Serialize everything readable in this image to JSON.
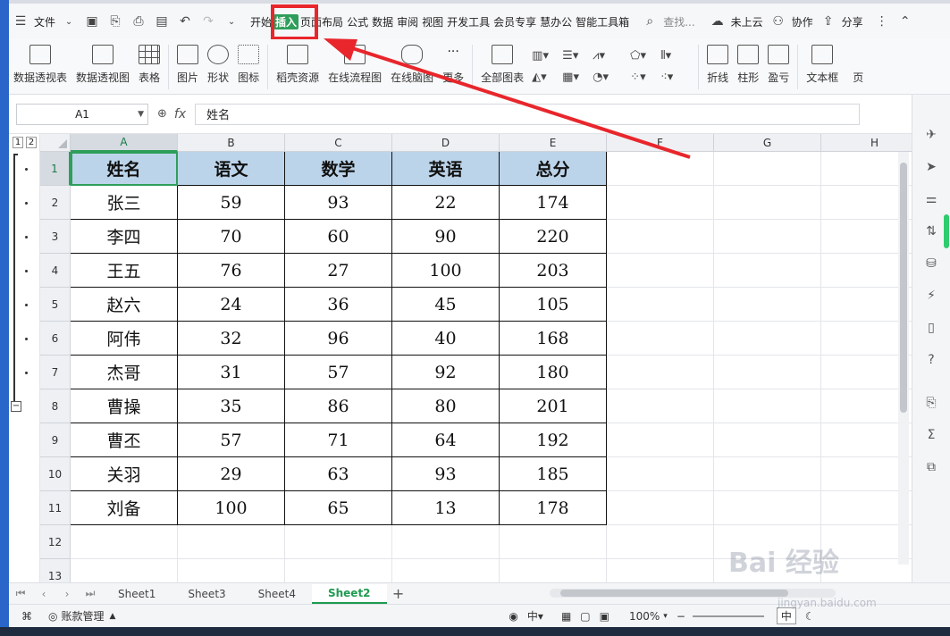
{
  "menubar": {
    "file_label": "文件",
    "tabs": [
      "开始",
      "插入",
      "页面布局",
      "公式",
      "数据",
      "审阅",
      "视图",
      "开发工具",
      "会员专享",
      "慧办公",
      "智能工具箱"
    ],
    "search_label": "查找...",
    "cloud_label": "未上云",
    "collab_label": "协作",
    "share_label": "分享"
  },
  "ribbon": {
    "pivot_table": "数据透视表",
    "pivot_chart": "数据透视图",
    "table": "表格",
    "picture": "图片",
    "shape": "形状",
    "icon": "图标",
    "resources": "稻壳资源",
    "flowchart": "在线流程图",
    "mindmap": "在线脑图",
    "more": "更多",
    "all_charts": "全部图表",
    "line": "折线",
    "column": "柱形",
    "winloss": "盈亏",
    "textbox": "文本框",
    "page": "页"
  },
  "formula_bar": {
    "name_box": "A1",
    "fx": "fx",
    "content": "姓名"
  },
  "columns": [
    "A",
    "B",
    "C",
    "D",
    "E",
    "F",
    "G",
    "H"
  ],
  "rows": [
    "1",
    "2",
    "3",
    "4",
    "5",
    "6",
    "7",
    "8",
    "9",
    "10",
    "11",
    "12",
    "13"
  ],
  "outline_levels": [
    "1",
    "2"
  ],
  "table": {
    "headers": [
      "姓名",
      "语文",
      "数学",
      "英语",
      "总分"
    ],
    "rows": [
      [
        "张三",
        "59",
        "93",
        "22",
        "174"
      ],
      [
        "李四",
        "70",
        "60",
        "90",
        "220"
      ],
      [
        "王五",
        "76",
        "27",
        "100",
        "203"
      ],
      [
        "赵六",
        "24",
        "36",
        "45",
        "105"
      ],
      [
        "阿伟",
        "32",
        "96",
        "40",
        "168"
      ],
      [
        "杰哥",
        "31",
        "57",
        "92",
        "180"
      ],
      [
        "曹操",
        "35",
        "86",
        "80",
        "201"
      ],
      [
        "曹丕",
        "57",
        "71",
        "64",
        "192"
      ],
      [
        "关羽",
        "29",
        "63",
        "93",
        "185"
      ],
      [
        "刘备",
        "100",
        "65",
        "13",
        "178"
      ]
    ]
  },
  "sheets": [
    "Sheet1",
    "Sheet3",
    "Sheet4",
    "Sheet2"
  ],
  "active_sheet": "Sheet2",
  "statusbar": {
    "account_label": "账款管理",
    "zoom": "100%",
    "ime": "中"
  },
  "watermark": {
    "text": "Bai 经验",
    "sub": "jingyan.baidu.com"
  },
  "colors": {
    "accent_green": "#2e9e5a",
    "header_fill": "#bcd4ea",
    "annotation_red": "#e8262b"
  }
}
